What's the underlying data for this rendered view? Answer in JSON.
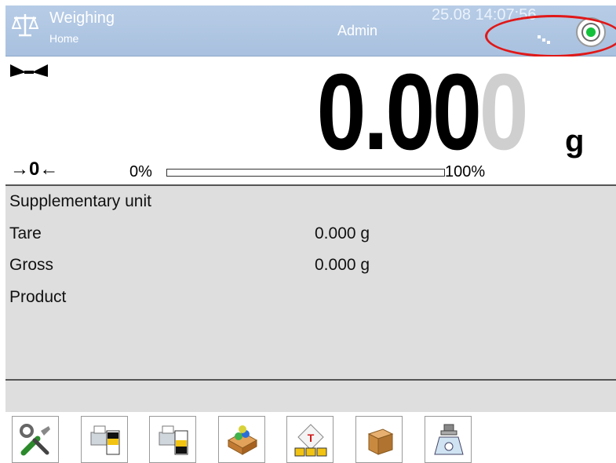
{
  "header": {
    "title": "Weighing",
    "subtitle": "Home",
    "user": "Admin",
    "datetime": "25.08 14:07:56",
    "icons": [
      "scale-icon",
      "transmission-dots-icon",
      "stability-target-icon"
    ]
  },
  "display": {
    "weight_main": "0.00",
    "weight_last_digit": "0",
    "unit": "g",
    "zero_indicator": "→0←",
    "bar_min_label": "0%",
    "bar_max_label": "100%",
    "bar_fill_fraction": 0
  },
  "info": {
    "rows": [
      {
        "label": "Supplementary unit",
        "value": ""
      },
      {
        "label": "Tare",
        "value": "0.000 g"
      },
      {
        "label": "Gross",
        "value": "0.000 g"
      },
      {
        "label": "Product",
        "value": ""
      }
    ]
  },
  "toolbar": {
    "buttons": [
      "settings-icon",
      "print-header-icon",
      "print-footer-icon",
      "product-database-icon",
      "tare-database-icon",
      "packaging-icon",
      "weighing-icon"
    ]
  },
  "colors": {
    "header_bg": "#b0c7e2",
    "info_bg": "#dedede",
    "stability_green": "#13c13a",
    "annotation_red": "#e01818"
  }
}
